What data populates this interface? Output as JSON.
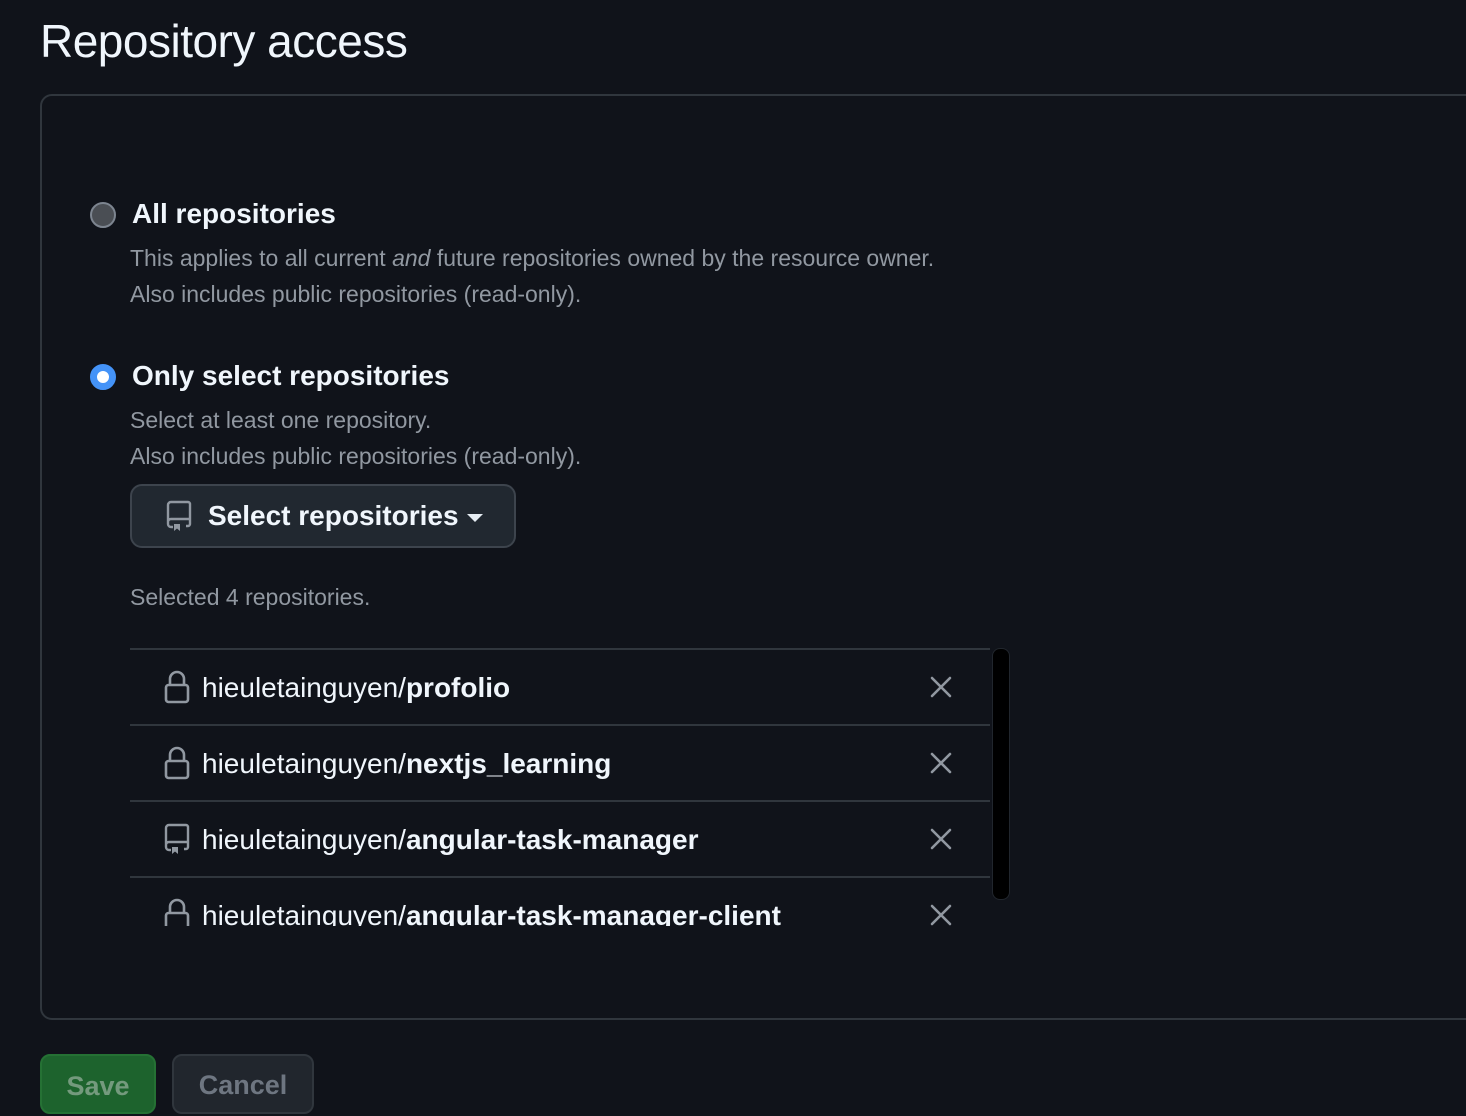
{
  "page": {
    "title": "Repository access"
  },
  "options": {
    "all": {
      "label": "All repositories",
      "desc_part1": "This applies to all current ",
      "desc_em": "and",
      "desc_part2": " future repositories owned by the resource owner.",
      "desc_line2": "Also includes public repositories (read-only).",
      "selected": false
    },
    "select": {
      "label": "Only select repositories",
      "desc_line1": "Select at least one repository.",
      "desc_line2": "Also includes public repositories (read-only).",
      "selected": true
    }
  },
  "select_button": {
    "label": "Select repositories",
    "icon": "repo-icon"
  },
  "selected_count_text": "Selected 4 repositories.",
  "repositories": [
    {
      "owner": "hieuletainguyen/",
      "name": "profolio",
      "icon": "lock-icon"
    },
    {
      "owner": "hieuletainguyen/",
      "name": "nextjs_learning",
      "icon": "lock-icon"
    },
    {
      "owner": "hieuletainguyen/",
      "name": "angular-task-manager",
      "icon": "repo-icon"
    },
    {
      "owner": "hieuletainguyen/",
      "name": "angular-task-manager-client",
      "icon": "lock-icon"
    }
  ],
  "actions": {
    "save_label": "Save",
    "cancel_label": "Cancel"
  },
  "colors": {
    "accent": "#4493f8",
    "save_green": "#238636",
    "background": "#10131a",
    "border": "#30363d"
  }
}
